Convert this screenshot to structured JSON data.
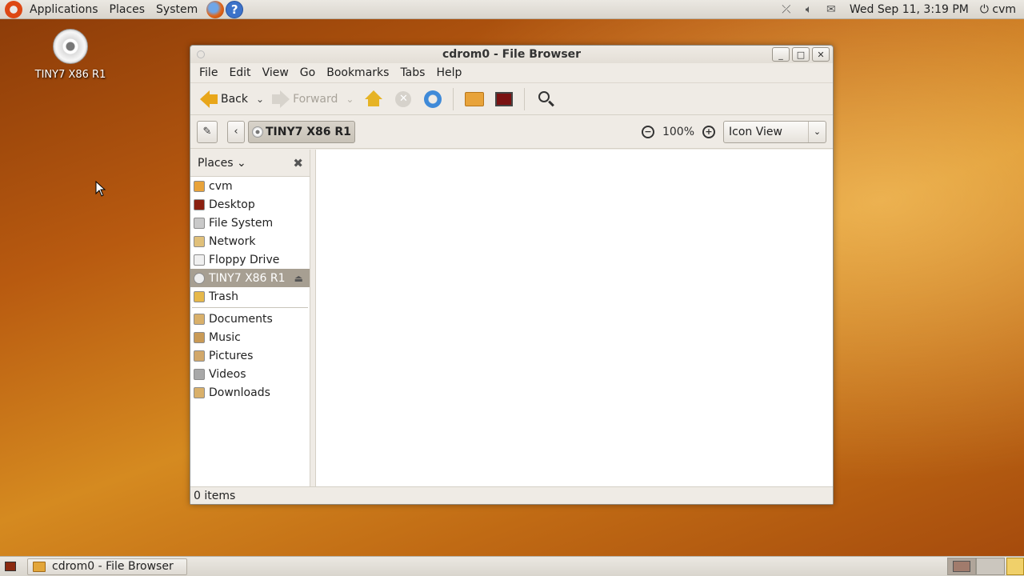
{
  "top_panel": {
    "menus": [
      "Applications",
      "Places",
      "System"
    ],
    "clock": "Wed Sep 11,  3:19 PM",
    "user": "cvm"
  },
  "desktop": {
    "icon_label": "TINY7 X86 R1"
  },
  "window": {
    "title": "cdrom0 - File Browser",
    "menu": [
      "File",
      "Edit",
      "View",
      "Go",
      "Bookmarks",
      "Tabs",
      "Help"
    ],
    "toolbar": {
      "back_label": "Back",
      "forward_label": "Forward"
    },
    "location": {
      "crumb": "TINY7 X86 R1",
      "zoom": "100%",
      "view_mode": "Icon View"
    },
    "sidebar": {
      "header": "Places",
      "places": [
        "cvm",
        "Desktop",
        "File System",
        "Network",
        "Floppy Drive",
        "TINY7 X86 R1",
        "Trash"
      ],
      "bookmarks": [
        "Documents",
        "Music",
        "Pictures",
        "Videos",
        "Downloads"
      ],
      "selected": "TINY7 X86 R1"
    },
    "status": "0 items"
  },
  "bottom_panel": {
    "task_label": "cdrom0 - File Browser"
  },
  "colors": {
    "selection": "#a79f92",
    "accent_orange": "#e8a61a"
  }
}
